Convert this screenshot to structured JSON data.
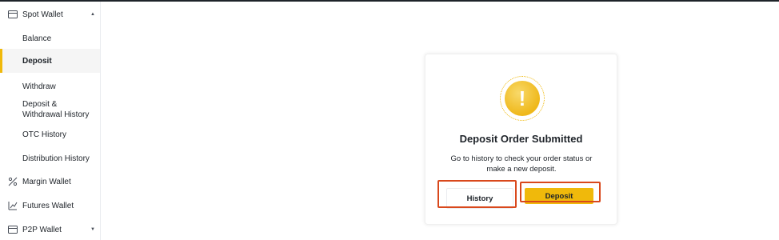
{
  "sidebar": {
    "spot_wallet": {
      "label": "Spot Wallet",
      "icon": "wallet-icon"
    },
    "items": [
      {
        "label": "Balance"
      },
      {
        "label": "Deposit"
      },
      {
        "label": "Withdraw"
      },
      {
        "label": "Deposit & Withdrawal History"
      },
      {
        "label": "OTC History"
      },
      {
        "label": "Distribution History"
      }
    ],
    "margin_wallet": {
      "label": "Margin Wallet",
      "icon": "margin-icon"
    },
    "futures_wallet": {
      "label": "Futures Wallet",
      "icon": "futures-icon"
    },
    "p2p_wallet": {
      "label": "P2P Wallet",
      "icon": "wallet-icon"
    }
  },
  "dialog": {
    "icon": "warning-icon",
    "glyph": "!",
    "title": "Deposit Order Submitted",
    "message": "Go to history to check your order status or make a new deposit.",
    "history_label": "History",
    "deposit_label": "Deposit"
  },
  "colors": {
    "accent": "#f0b90b",
    "highlight": "#d9481c"
  }
}
